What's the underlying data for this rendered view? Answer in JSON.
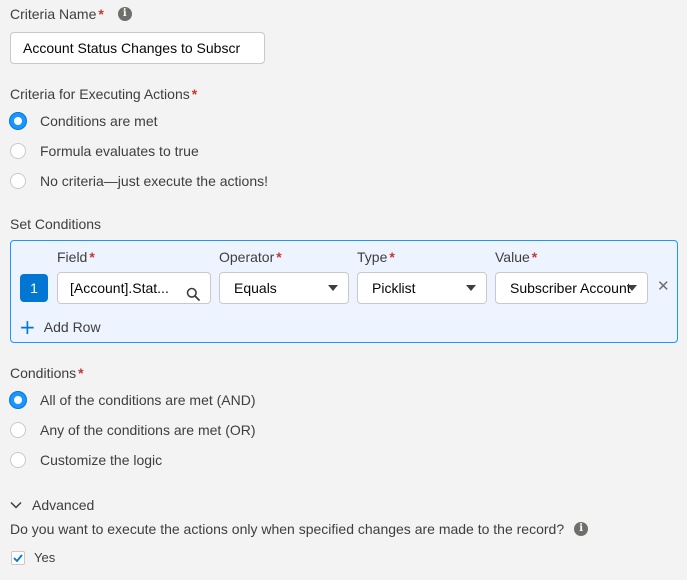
{
  "criteria_name": {
    "label": "Criteria Name",
    "required_mark": "*",
    "value": "Account Status Changes to Subscr"
  },
  "executing_actions": {
    "label": "Criteria for Executing Actions",
    "required_mark": "*",
    "options": [
      {
        "label": "Conditions are met",
        "checked": true
      },
      {
        "label": "Formula evaluates to true",
        "checked": false
      },
      {
        "label": "No criteria—just execute the actions!",
        "checked": false
      }
    ]
  },
  "set_conditions": {
    "label": "Set Conditions",
    "columns": {
      "field": "Field",
      "operator": "Operator",
      "type": "Type",
      "value": "Value",
      "required_mark": "*"
    },
    "rows": [
      {
        "number": "1",
        "field": "[Account].Stat...",
        "operator": "Equals",
        "type": "Picklist",
        "value": "Subscriber Account"
      }
    ],
    "add_row_label": "Add Row",
    "remove_icon": "✕",
    "add_icon": "+"
  },
  "conditions": {
    "label": "Conditions",
    "required_mark": "*",
    "options": [
      {
        "label": "All of the conditions are met (AND)",
        "checked": true
      },
      {
        "label": "Any of the conditions are met (OR)",
        "checked": false
      },
      {
        "label": "Customize the logic",
        "checked": false
      }
    ]
  },
  "advanced": {
    "label": "Advanced",
    "question": "Do you want to execute the actions only when specified changes are made to the record?",
    "checkbox_label": "Yes",
    "checkbox_checked": true
  },
  "colors": {
    "accent": "#0176d3",
    "required": "#c23934",
    "panel_border": "#1b96ff"
  }
}
